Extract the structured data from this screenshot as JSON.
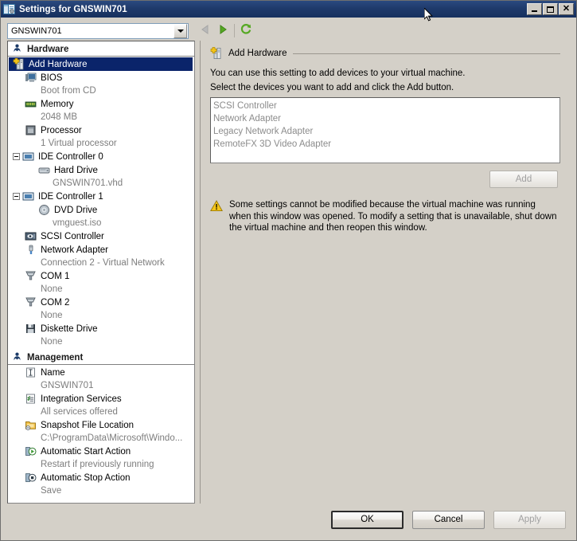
{
  "window": {
    "title": "Settings for GNSWIN701",
    "icon": "hyperv-settings-icon",
    "buttons": {
      "minimize": "minimize-icon",
      "maximize": "maximize-icon",
      "close": "close-icon"
    }
  },
  "toolbar": {
    "vm_selector": {
      "value": "GNSWIN701",
      "icon": "chevron-down-icon"
    },
    "back": "back-arrow-icon",
    "forward": "forward-arrow-icon",
    "refresh": "refresh-icon"
  },
  "tree": {
    "groups": [
      {
        "label": "Hardware",
        "icon": "hardware-group-icon",
        "items": [
          {
            "label": "Add Hardware",
            "icon": "add-hardware-icon",
            "sub": "",
            "selected": true,
            "indent": 1,
            "expander": false
          },
          {
            "label": "BIOS",
            "icon": "bios-icon",
            "sub": "Boot from CD",
            "selected": false,
            "indent": 1,
            "expander": false
          },
          {
            "label": "Memory",
            "icon": "memory-icon",
            "sub": "2048 MB",
            "selected": false,
            "indent": 1,
            "expander": false
          },
          {
            "label": "Processor",
            "icon": "processor-icon",
            "sub": "1 Virtual processor",
            "selected": false,
            "indent": 1,
            "expander": false
          },
          {
            "label": "IDE Controller 0",
            "icon": "ide-controller-icon",
            "sub": "",
            "selected": false,
            "indent": 0,
            "expander": true
          },
          {
            "label": "Hard Drive",
            "icon": "hard-drive-icon",
            "sub": "GNSWIN701.vhd",
            "selected": false,
            "indent": 2,
            "expander": false
          },
          {
            "label": "IDE Controller 1",
            "icon": "ide-controller-icon",
            "sub": "",
            "selected": false,
            "indent": 0,
            "expander": true
          },
          {
            "label": "DVD Drive",
            "icon": "dvd-drive-icon",
            "sub": "vmguest.iso",
            "selected": false,
            "indent": 2,
            "expander": false
          },
          {
            "label": "SCSI Controller",
            "icon": "scsi-controller-icon",
            "sub": "",
            "selected": false,
            "indent": 1,
            "expander": false
          },
          {
            "label": "Network Adapter",
            "icon": "network-adapter-icon",
            "sub": "Connection 2 - Virtual Network",
            "selected": false,
            "indent": 1,
            "expander": false
          },
          {
            "label": "COM 1",
            "icon": "com-port-icon",
            "sub": "None",
            "selected": false,
            "indent": 1,
            "expander": false
          },
          {
            "label": "COM 2",
            "icon": "com-port-icon",
            "sub": "None",
            "selected": false,
            "indent": 1,
            "expander": false
          },
          {
            "label": "Diskette Drive",
            "icon": "diskette-drive-icon",
            "sub": "None",
            "selected": false,
            "indent": 1,
            "expander": false
          }
        ]
      },
      {
        "label": "Management",
        "icon": "management-group-icon",
        "items": [
          {
            "label": "Name",
            "icon": "name-icon",
            "sub": "GNSWIN701",
            "selected": false,
            "indent": 1,
            "expander": false
          },
          {
            "label": "Integration Services",
            "icon": "integration-services-icon",
            "sub": "All services offered",
            "selected": false,
            "indent": 1,
            "expander": false
          },
          {
            "label": "Snapshot File Location",
            "icon": "snapshot-folder-icon",
            "sub": "C:\\ProgramData\\Microsoft\\Windo...",
            "selected": false,
            "indent": 1,
            "expander": false
          },
          {
            "label": "Automatic Start Action",
            "icon": "automatic-start-icon",
            "sub": "Restart if previously running",
            "selected": false,
            "indent": 1,
            "expander": false
          },
          {
            "label": "Automatic Stop Action",
            "icon": "automatic-stop-icon",
            "sub": "Save",
            "selected": false,
            "indent": 1,
            "expander": false
          }
        ]
      }
    ]
  },
  "detail": {
    "header": {
      "title": "Add Hardware",
      "icon": "add-hardware-icon"
    },
    "paragraphs": [
      "You can use this setting to add devices to your virtual machine.",
      "Select the devices you want to add and click the Add button."
    ],
    "device_list": [
      "SCSI Controller",
      "Network Adapter",
      "Legacy Network Adapter",
      "RemoteFX 3D Video Adapter"
    ],
    "add_button": {
      "label": "Add",
      "disabled": true
    },
    "warning": {
      "icon": "warning-icon",
      "text": "Some settings cannot be modified because the virtual machine was running when this window was opened. To modify a setting that is unavailable, shut down the virtual machine and then reopen this window."
    }
  },
  "footer": {
    "ok": "OK",
    "cancel": "Cancel",
    "apply": "Apply"
  },
  "colors": {
    "titlebar": "#1f3a6b",
    "selection": "#0a246a",
    "window_face": "#d4d0c8",
    "disabled_text": "#8c8c8c",
    "sub_text": "#7d7d7d",
    "accent_green": "#55a822",
    "warning_yellow": "#f0c419"
  }
}
